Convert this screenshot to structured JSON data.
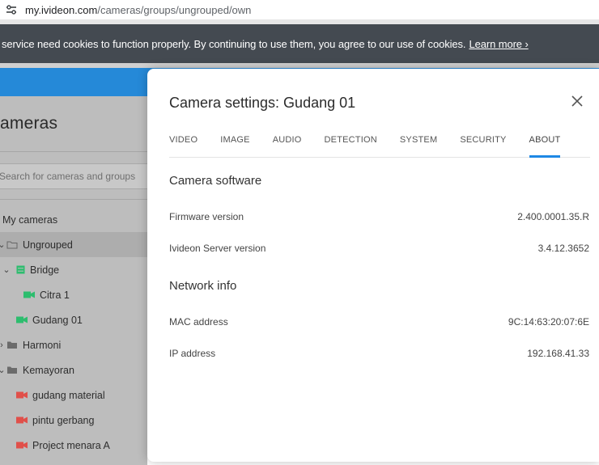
{
  "browser": {
    "url_host": "my.ivideon.com",
    "url_path": "/cameras/groups/ungrouped/own"
  },
  "cookie_banner": {
    "text": "service need cookies to function properly. By continuing to use them, you agree to our use of cookies.",
    "link": "Learn more ›"
  },
  "sidebar": {
    "title": "ameras",
    "search_placeholder": "Search for cameras and groups",
    "items": [
      {
        "label": "My cameras"
      },
      {
        "label": "Ungrouped"
      },
      {
        "label": "Bridge"
      },
      {
        "label": "Citra 1"
      },
      {
        "label": "Gudang 01"
      },
      {
        "label": "Harmoni"
      },
      {
        "label": "Kemayoran"
      },
      {
        "label": "gudang material"
      },
      {
        "label": "pintu gerbang"
      },
      {
        "label": "Project menara A"
      }
    ]
  },
  "modal": {
    "title": "Camera settings: Gudang 01",
    "tabs": [
      "VIDEO",
      "IMAGE",
      "AUDIO",
      "DETECTION",
      "SYSTEM",
      "SECURITY",
      "ABOUT"
    ],
    "active_tab": "ABOUT",
    "software": {
      "title": "Camera software",
      "firmware_label": "Firmware version",
      "firmware_value": "2.400.0001.35.R",
      "server_label": "Ivideon Server version",
      "server_value": "3.4.12.3652"
    },
    "network": {
      "title": "Network info",
      "mac_label": "MAC address",
      "mac_value": "9C:14:63:20:07:6E",
      "ip_label": "IP address",
      "ip_value": "192.168.41.33"
    }
  },
  "colors": {
    "accent": "#1e88e5",
    "header_blue": "#2589d8",
    "camera_green": "#2dbd6e",
    "camera_red": "#e0504a"
  }
}
